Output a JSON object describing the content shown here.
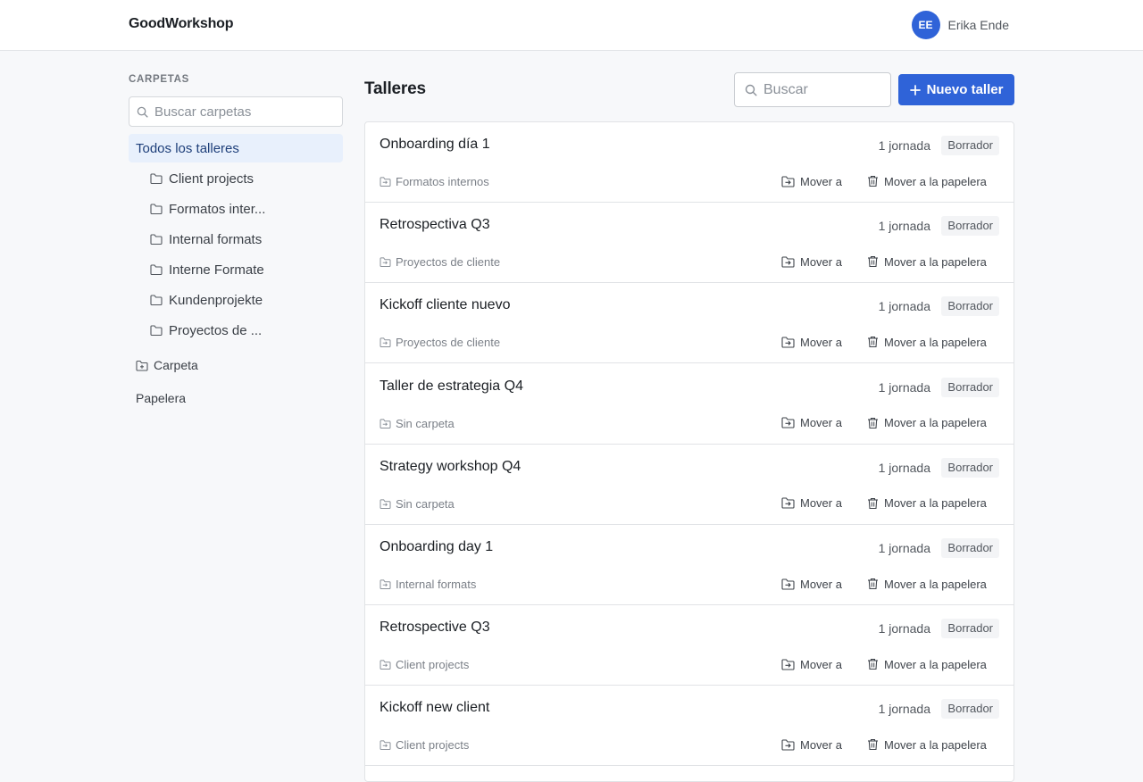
{
  "header": {
    "brand": "GoodWorkshop",
    "user": {
      "initials": "EE",
      "name": "Erika Ende"
    }
  },
  "sidebar": {
    "title": "CARPETAS",
    "search_placeholder": "Buscar carpetas",
    "all_label": "Todos los talleres",
    "folders": [
      {
        "label": "Client projects"
      },
      {
        "label": "Formatos inter..."
      },
      {
        "label": "Internal formats"
      },
      {
        "label": "Interne Formate"
      },
      {
        "label": "Kundenprojekte"
      },
      {
        "label": "Proyectos de ..."
      }
    ],
    "new_folder_label": "Carpeta",
    "trash_label": "Papelera"
  },
  "main": {
    "title": "Talleres",
    "search_placeholder": "Buscar",
    "new_button_label": "Nuevo taller",
    "move_label": "Mover a",
    "trash_label": "Mover a la papelera",
    "workshops": [
      {
        "title": "Onboarding día 1",
        "days": "1 jornada",
        "status": "Borrador",
        "folder": "Formatos internos"
      },
      {
        "title": "Retrospectiva Q3",
        "days": "1 jornada",
        "status": "Borrador",
        "folder": "Proyectos de cliente"
      },
      {
        "title": "Kickoff cliente nuevo",
        "days": "1 jornada",
        "status": "Borrador",
        "folder": "Proyectos de cliente"
      },
      {
        "title": "Taller de estrategia Q4",
        "days": "1 jornada",
        "status": "Borrador",
        "folder": "Sin carpeta"
      },
      {
        "title": "Strategy workshop Q4",
        "days": "1 jornada",
        "status": "Borrador",
        "folder": "Sin carpeta"
      },
      {
        "title": "Onboarding day 1",
        "days": "1 jornada",
        "status": "Borrador",
        "folder": "Internal formats"
      },
      {
        "title": "Retrospective Q3",
        "days": "1 jornada",
        "status": "Borrador",
        "folder": "Client projects"
      },
      {
        "title": "Kickoff new client",
        "days": "1 jornada",
        "status": "Borrador",
        "folder": "Client projects"
      }
    ]
  },
  "colors": {
    "accent": "#2f63d8",
    "selected_bg": "#e8f0fc",
    "page_bg": "#f7f8fa"
  }
}
